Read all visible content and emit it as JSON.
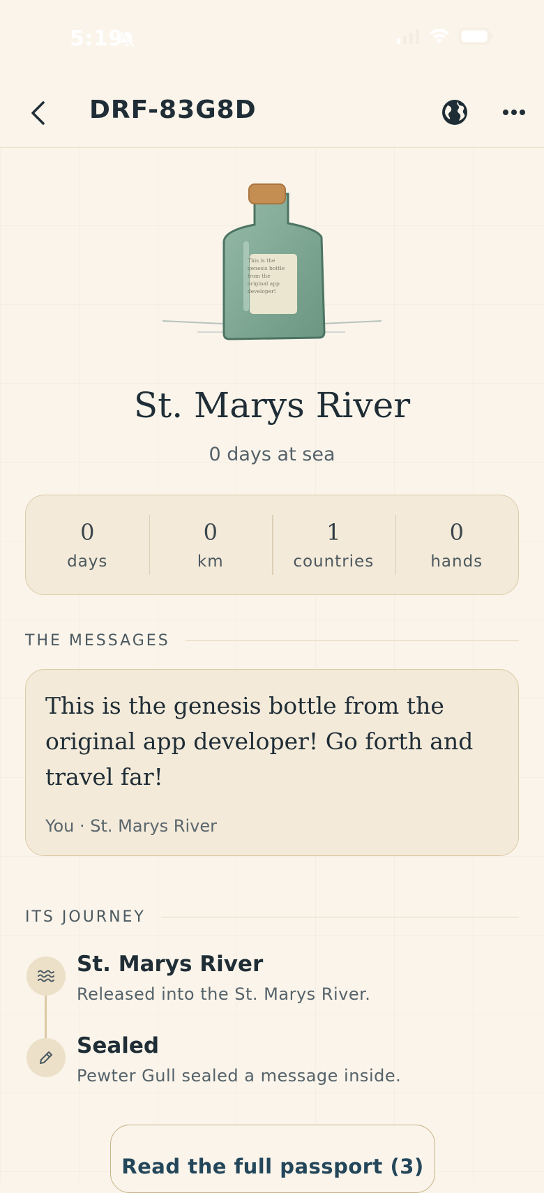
{
  "status_bar": {
    "time": "5:19"
  },
  "header": {
    "title": "DRF-83G8D"
  },
  "bottle": {
    "label_text": "This is the genesis bottle from the original app developer! Go..."
  },
  "place": {
    "title": "St. Marys River",
    "subtitle": "0 days at sea"
  },
  "stats": [
    {
      "value": "0",
      "label": "days"
    },
    {
      "value": "0",
      "label": "km"
    },
    {
      "value": "1",
      "label": "countries"
    },
    {
      "value": "0",
      "label": "hands"
    }
  ],
  "messages": {
    "heading": "THE MESSAGES",
    "items": [
      {
        "text": "This is the genesis bottle from the original app developer! Go forth and travel far!",
        "meta": "You · St. Marys River"
      }
    ]
  },
  "journey": {
    "heading": "ITS JOURNEY",
    "events": [
      {
        "icon": "waves-icon",
        "title": "St. Marys River",
        "desc": "Released into the St. Marys River."
      },
      {
        "icon": "pencil-icon",
        "title": "Sealed",
        "desc": "Pewter Gull sealed a message inside."
      }
    ]
  },
  "passport_button": {
    "label": "Read the full passport (3)"
  },
  "colors": {
    "background": "#faf4ea",
    "card": "#f3ead9",
    "card_border": "#dccaa6",
    "bottle": "#7fa894",
    "cork": "#c48d52",
    "accent_text": "#23465a"
  }
}
